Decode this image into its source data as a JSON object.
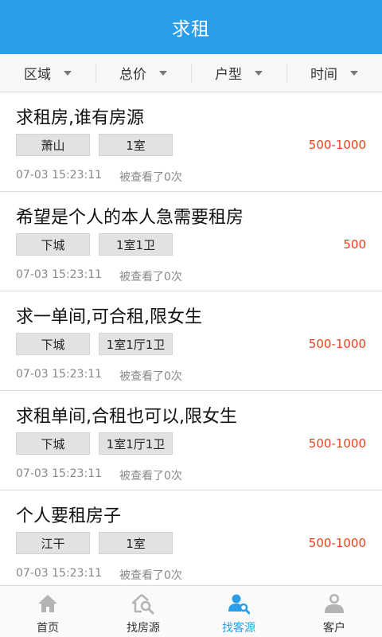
{
  "header": {
    "title": "求租"
  },
  "filters": [
    {
      "label": "区域"
    },
    {
      "label": "总价"
    },
    {
      "label": "户型"
    },
    {
      "label": "时间"
    }
  ],
  "listings": [
    {
      "title": "求租房,谁有房源",
      "area": "萧山",
      "layout": "1室",
      "price": "500-1000",
      "time": "07-03 15:23:11",
      "views": "被查看了0次"
    },
    {
      "title": "希望是个人的本人急需要租房",
      "area": "下城",
      "layout": "1室1卫",
      "price": "500",
      "time": "07-03 15:23:11",
      "views": "被查看了0次"
    },
    {
      "title": "求一单间,可合租,限女生",
      "area": "下城",
      "layout": "1室1厅1卫",
      "price": "500-1000",
      "time": "07-03 15:23:11",
      "views": "被查看了0次"
    },
    {
      "title": "求租单间,合租也可以,限女生",
      "area": "下城",
      "layout": "1室1厅1卫",
      "price": "500-1000",
      "time": "07-03 15:23:11",
      "views": "被查看了0次"
    },
    {
      "title": "个人要租房子",
      "area": "江干",
      "layout": "1室",
      "price": "500-1000",
      "time": "07-03 15:23:11",
      "views": "被查看了0次"
    }
  ],
  "tabs": [
    {
      "label": "首页",
      "icon": "home-icon",
      "active": false
    },
    {
      "label": "找房源",
      "icon": "house-search-icon",
      "active": false
    },
    {
      "label": "找客源",
      "icon": "person-search-icon",
      "active": true
    },
    {
      "label": "客户",
      "icon": "customers-icon",
      "active": false
    }
  ],
  "colors": {
    "primary": "#2a9ee8",
    "price": "#e5431d",
    "tab_inactive": "#b3b3b3"
  }
}
